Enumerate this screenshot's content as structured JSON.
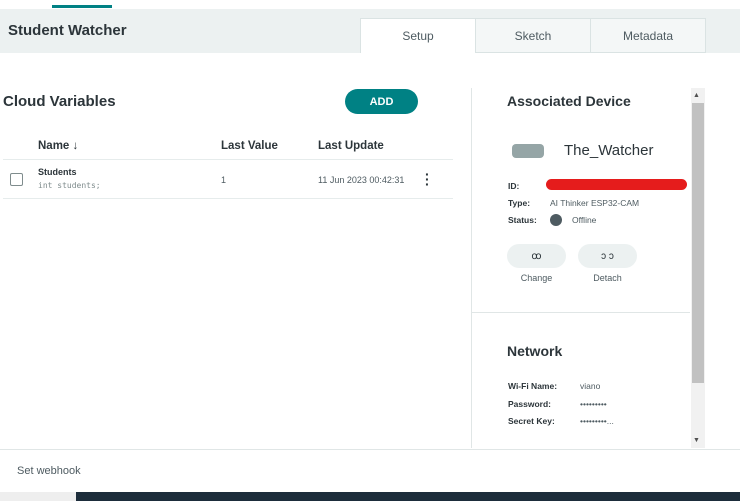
{
  "header": {
    "title": "Student Watcher",
    "tabs": [
      {
        "label": "Setup",
        "active": true
      },
      {
        "label": "Sketch"
      },
      {
        "label": "Metadata"
      }
    ]
  },
  "variables": {
    "title": "Cloud Variables",
    "add_label": "ADD",
    "columns": [
      "Name",
      "Last Value",
      "Last Update"
    ],
    "rows": [
      {
        "name": "Students",
        "declaration": "int students;",
        "last_value": "1",
        "last_update": "11 Jun 2023 00:42:31"
      }
    ]
  },
  "device": {
    "title": "Associated Device",
    "name": "The_Watcher",
    "id_label": "ID:",
    "type_label": "Type:",
    "type": "AI Thinker ESP32-CAM",
    "status_label": "Status:",
    "status": "Offline",
    "change_label": "Change",
    "detach_label": "Detach"
  },
  "network": {
    "title": "Network",
    "wifi_label": "Wi-Fi Name:",
    "wifi": "viano",
    "password_label": "Password:",
    "password": "•••••••••",
    "secret_label": "Secret Key:",
    "secret": "•••••••••..."
  },
  "footer": {
    "webhook": "Set webhook"
  },
  "colors": {
    "accent": "#008184",
    "redaction": "#e51c1c"
  }
}
